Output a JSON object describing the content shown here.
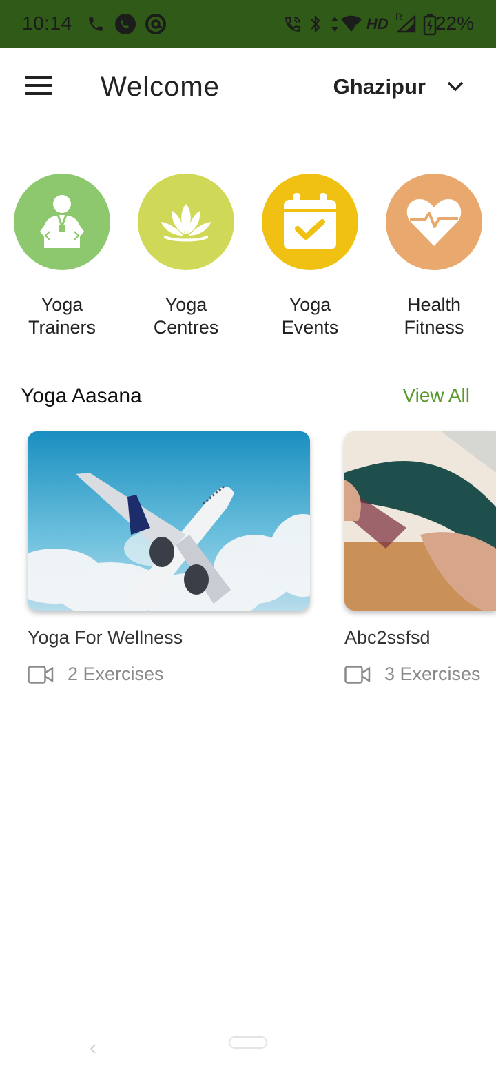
{
  "status_bar": {
    "time": "10:14",
    "battery": "22%",
    "icons": [
      "phone-icon",
      "whatsapp-icon",
      "at-icon",
      "wifi-calling-icon",
      "bluetooth-icon",
      "data-arrows-icon",
      "wifi-icon",
      "hd-icon",
      "signal-icon",
      "battery-charging-icon"
    ],
    "network_label": "HD",
    "signal_badge": "R",
    "background": "#2f5a18"
  },
  "header": {
    "menu_icon": "hamburger-menu-icon",
    "title": "Welcome",
    "location": "Ghazipur",
    "dropdown_icon": "chevron-down-icon"
  },
  "categories": [
    {
      "line1": "Yoga",
      "line2": "Trainers",
      "icon": "trainer-icon",
      "color": "#8dc86e"
    },
    {
      "line1": "Yoga",
      "line2": "Centres",
      "icon": "lotus-icon",
      "color": "#cfd957"
    },
    {
      "line1": "Yoga",
      "line2": "Events",
      "icon": "calendar-check-icon",
      "color": "#f0c013"
    },
    {
      "line1": "Health",
      "line2": "Fitness",
      "icon": "heart-pulse-icon",
      "color": "#e9a96e"
    }
  ],
  "section": {
    "title": "Yoga Aasana",
    "view_all": "View All",
    "accent": "#5a9a2c"
  },
  "cards": [
    {
      "title": "Yoga For Wellness",
      "exercises": "2 Exercises",
      "image": "airplane-image"
    },
    {
      "title": "Abc2ssfsd",
      "exercises": "3 Exercises",
      "image": "yoga-pose-image"
    }
  ]
}
